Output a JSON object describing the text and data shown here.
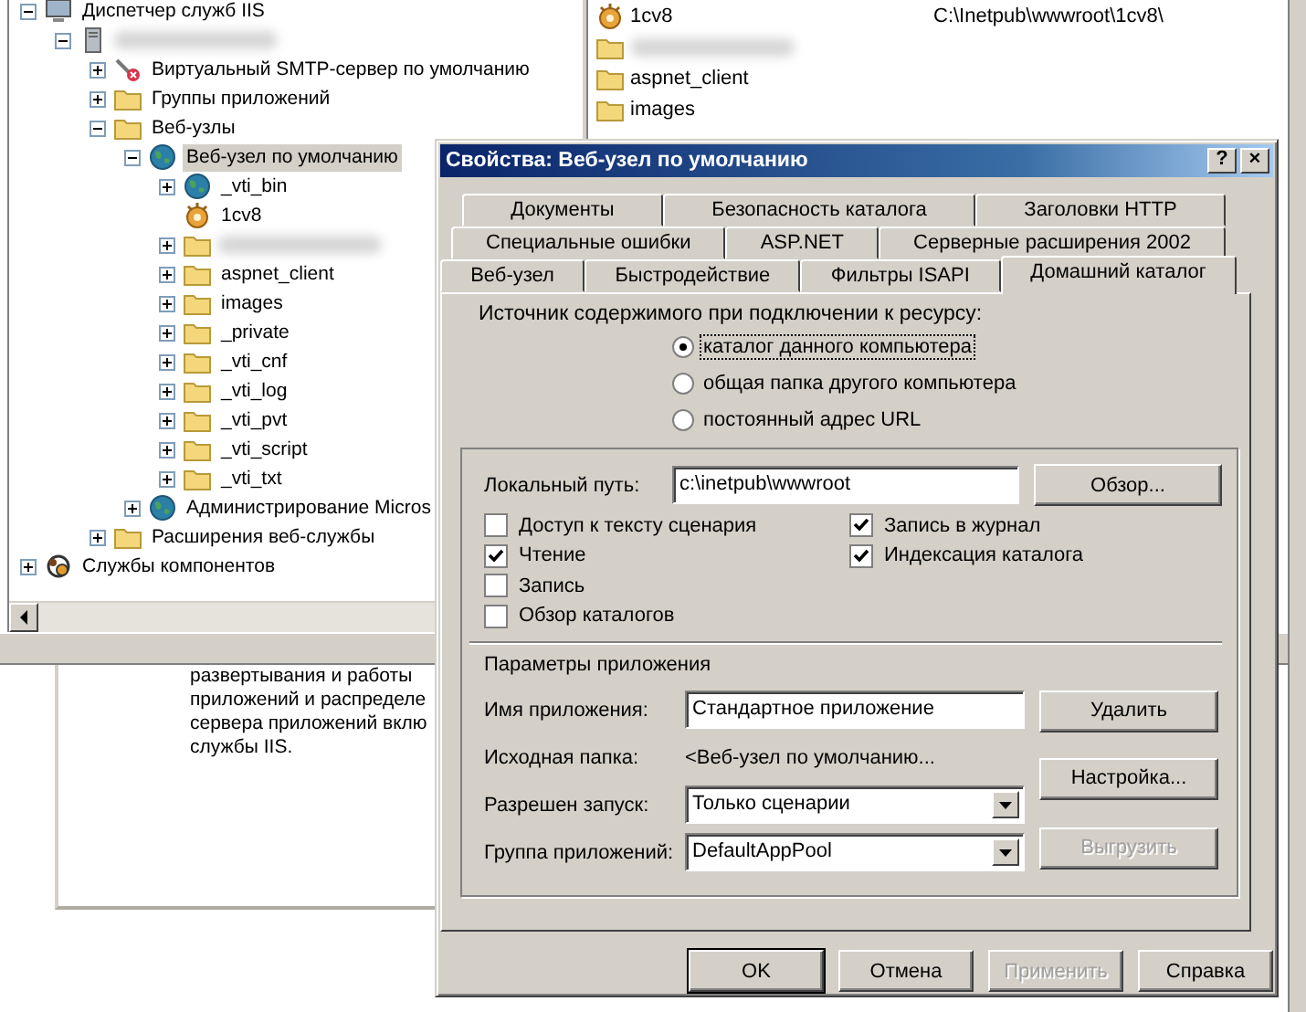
{
  "tree": {
    "items": [
      {
        "label": "Диспетчер служб IIS",
        "kind": "computer",
        "expanded": true,
        "selected": false,
        "children": [
          {
            "kind": "server",
            "expanded": true,
            "selected": false,
            "children": [
              {
                "label": "Виртуальный SMTP-сервер по умолчанию",
                "kind": "smtp",
                "expanded": false,
                "selected": false
              },
              {
                "label": "Группы приложений",
                "kind": "folder",
                "expanded": false,
                "selected": false
              },
              {
                "label": "Веб-узлы",
                "kind": "folder",
                "expanded": true,
                "selected": false,
                "children": [
                  {
                    "label": "Веб-узел по умолчанию",
                    "kind": "globe",
                    "expanded": true,
                    "selected": true,
                    "children": [
                      {
                        "label": "_vti_bin",
                        "kind": "globe",
                        "expanded": false,
                        "selected": false
                      },
                      {
                        "label": "1cv8",
                        "kind": "gear",
                        "selected": false
                      },
                      {
                        "kind": "folder",
                        "expanded": false,
                        "selected": false
                      },
                      {
                        "label": "aspnet_client",
                        "kind": "folder",
                        "expanded": false,
                        "selected": false
                      },
                      {
                        "label": "images",
                        "kind": "folder",
                        "expanded": false,
                        "selected": false
                      },
                      {
                        "label": "_private",
                        "kind": "folder",
                        "expanded": false,
                        "selected": false
                      },
                      {
                        "label": "_vti_cnf",
                        "kind": "folder",
                        "expanded": false,
                        "selected": false
                      },
                      {
                        "label": "_vti_log",
                        "kind": "folder",
                        "expanded": false,
                        "selected": false
                      },
                      {
                        "label": "_vti_pvt",
                        "kind": "folder",
                        "expanded": false,
                        "selected": false
                      },
                      {
                        "label": "_vti_script",
                        "kind": "folder",
                        "expanded": false,
                        "selected": false
                      },
                      {
                        "label": "_vti_txt",
                        "kind": "folder",
                        "expanded": false,
                        "selected": false
                      }
                    ]
                  },
                  {
                    "label": "Администрирование Micros",
                    "kind": "globe",
                    "expanded": false,
                    "selected": false
                  }
                ]
              },
              {
                "label": "Расширения веб-службы",
                "kind": "folder",
                "expanded": false,
                "selected": false
              }
            ]
          }
        ]
      },
      {
        "label": "Службы компонентов",
        "kind": "components",
        "expanded": false,
        "selected": false
      }
    ]
  },
  "list": {
    "items": [
      {
        "label": "1cv8",
        "kind": "gear",
        "path": "C:\\Inetpub\\wwwroot\\1cv8\\"
      },
      {
        "kind": "folder"
      },
      {
        "label": "aspnet_client",
        "kind": "folder"
      },
      {
        "label": "images",
        "kind": "folder"
      }
    ]
  },
  "description": {
    "lines": [
      "развертывания и работы",
      "приложений и распределе",
      "сервера приложений вклю",
      "службы IIS."
    ]
  },
  "dialog": {
    "title": "Свойства: Веб-узел по умолчанию",
    "title_buttons": [
      "?",
      "×"
    ],
    "tab_rows": [
      [
        {
          "label": "Документы",
          "selected": false
        },
        {
          "label": "Безопасность каталога",
          "selected": false
        },
        {
          "label": "Заголовки HTTP",
          "selected": false
        }
      ],
      [
        {
          "label": "Специальные ошибки",
          "selected": false
        },
        {
          "label": "ASP.NET",
          "selected": false
        },
        {
          "label": "Серверные расширения 2002",
          "selected": false
        }
      ],
      [
        {
          "label": "Веб-узел",
          "selected": false
        },
        {
          "label": "Быстродействие",
          "selected": false
        },
        {
          "label": "Фильтры ISAPI",
          "selected": false
        },
        {
          "label": "Домашний каталог",
          "selected": true
        }
      ]
    ],
    "source_label": "Источник содержимого при подключении к ресурсу:",
    "source_options": [
      {
        "label": "каталог данного компьютера",
        "selected": true
      },
      {
        "label": "общая папка другого компьютера",
        "selected": false
      },
      {
        "label": "постоянный адрес URL",
        "selected": false
      }
    ],
    "local_path": {
      "label": "Локальный путь:",
      "value": "c:\\inetpub\\wwwroot",
      "button": "Обзор..."
    },
    "permissions_left": [
      {
        "label": "Доступ к тексту сценария",
        "checked": false
      },
      {
        "label": "Чтение",
        "checked": true
      },
      {
        "label": "Запись",
        "checked": false
      },
      {
        "label": "Обзор каталогов",
        "checked": false
      }
    ],
    "permissions_right": [
      {
        "label": "Запись в журнал",
        "checked": true
      },
      {
        "label": "Индексация каталога",
        "checked": true
      }
    ],
    "app_heading": "Параметры приложения",
    "app_fields": [
      {
        "kind": "input",
        "label": "Имя приложения:",
        "value": "Стандартное приложение"
      },
      {
        "kind": "text",
        "label": "Исходная папка:",
        "value": "<Веб-узел по умолчанию..."
      },
      {
        "kind": "select",
        "label": "Разрешен запуск:",
        "value": "Только сценарии"
      },
      {
        "kind": "select",
        "label": "Группа приложений:",
        "value": "DefaultAppPool"
      }
    ],
    "app_buttons": [
      {
        "label": "Удалить",
        "disabled": false
      },
      {
        "label": "Настройка...",
        "disabled": false
      },
      {
        "label": "Выгрузить",
        "disabled": true
      }
    ],
    "buttons": [
      {
        "label": "OK",
        "default": true,
        "disabled": false
      },
      {
        "label": "Отмена",
        "default": false,
        "disabled": false
      },
      {
        "label": "Применить",
        "default": false,
        "disabled": true
      },
      {
        "label": "Справка",
        "default": false,
        "disabled": false
      }
    ]
  }
}
